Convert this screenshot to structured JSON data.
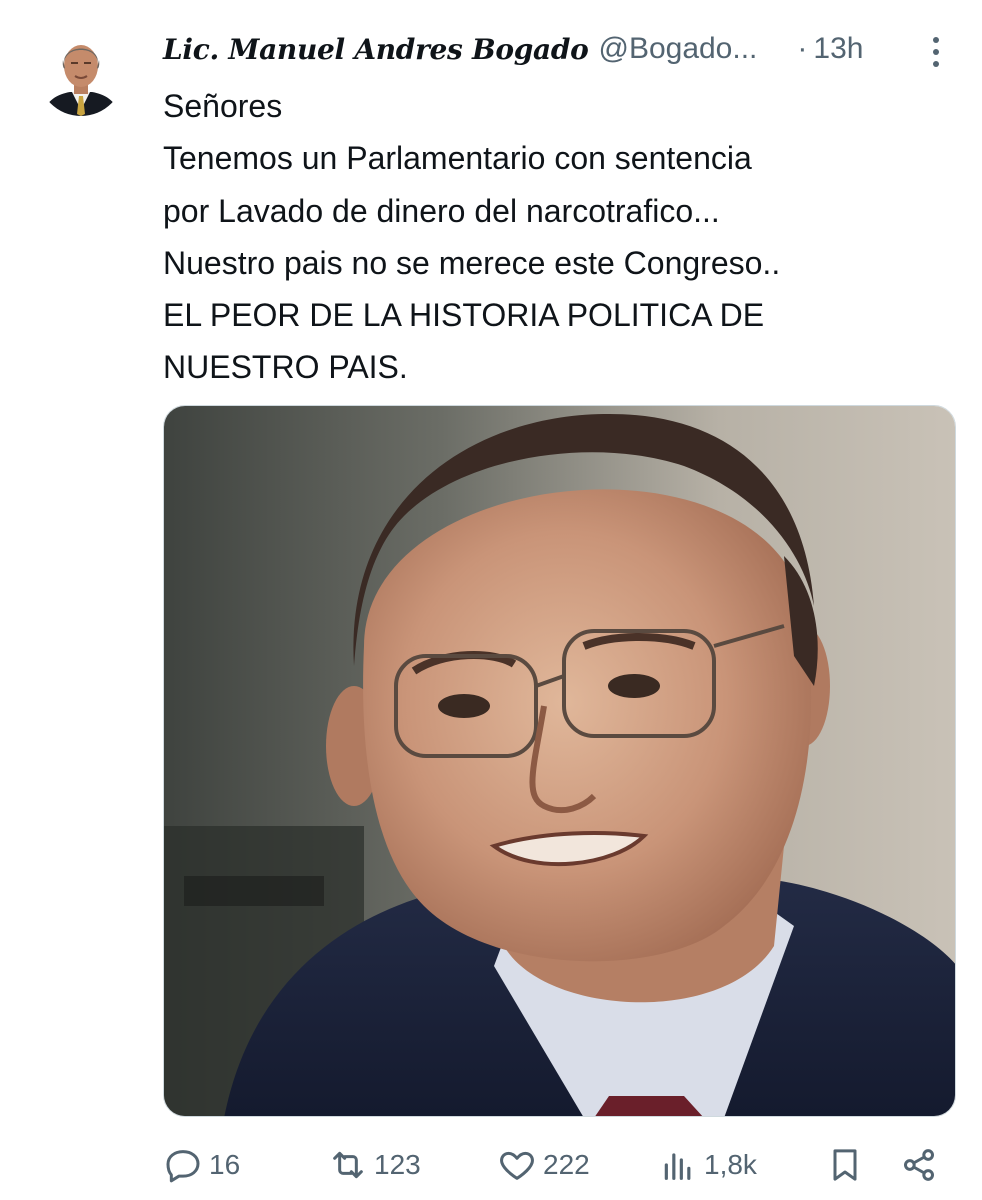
{
  "tweet": {
    "author": {
      "display_name": "Lic. Manuel Andres Bogado",
      "handle": "@Bogado...",
      "avatar_icon": "profile-photo"
    },
    "separator": "·",
    "time": "13h",
    "more_icon": "more-vertical-icon",
    "text_lines": [
      "Señores",
      "Tenemos un Parlamentario con sentencia",
      "por Lavado de dinero del narcotrafico...",
      "Nuestro pais no se merece este Congreso..",
      "EL PEOR DE LA HISTORIA POLITICA DE",
      "NUESTRO PAIS."
    ],
    "media": {
      "type": "photo",
      "border_color": "#cfd9de"
    },
    "actions": {
      "replies": "16",
      "retweets": "123",
      "likes": "222",
      "views": "1,8k"
    }
  },
  "colors": {
    "text_primary": "#0f1419",
    "text_secondary": "#536471",
    "background": "#ffffff"
  }
}
